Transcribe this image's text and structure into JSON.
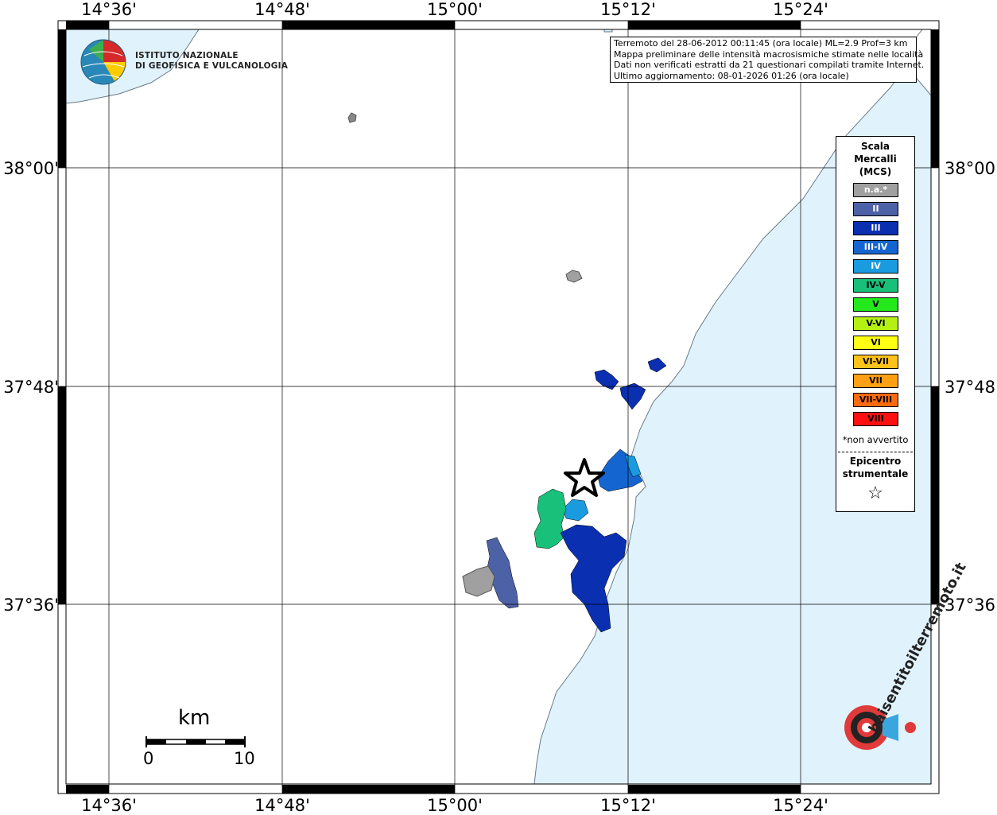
{
  "map": {
    "longitude_ticks": [
      "14°36'",
      "14°48'",
      "15°00'",
      "15°12'",
      "15°24'"
    ],
    "latitude_ticks": [
      "38°00'",
      "37°48'",
      "37°36'"
    ],
    "colors": {
      "sea": "#e0f2fc",
      "land": "#ffffff",
      "coast": "#6a7b88",
      "grid": "#000000"
    }
  },
  "institute": {
    "line1": "ISTITUTO NAZIONALE",
    "line2": "DI GEOFISICA E VULCANOLOGIA",
    "icon": "ingv-globe-logo"
  },
  "info": {
    "line1": "Terremoto del 28-06-2012 00:11:45 (ora locale) ML=2.9 Prof=3 km",
    "line2": "Mappa preliminare delle intensità macrosismiche stimate nelle località",
    "line3": "Dati non verificati estratti da 21 questionari compilati tramite Internet.",
    "line4": "Ultimo aggiornamento: 08-01-2026 01:26 (ora locale)"
  },
  "legend": {
    "title1": "Scala",
    "title2": "Mercalli",
    "title3": "(MCS)",
    "items": [
      {
        "label": "n.a.*",
        "color": "#a0a0a0",
        "text_color": "#ffffff"
      },
      {
        "label": "II",
        "color": "#4d62a6",
        "text_color": "#ffffff"
      },
      {
        "label": "III",
        "color": "#0a2fb0",
        "text_color": "#ffffff"
      },
      {
        "label": "III-IV",
        "color": "#1565d0",
        "text_color": "#ffffff"
      },
      {
        "label": "IV",
        "color": "#1a9be0",
        "text_color": "#ffffff"
      },
      {
        "label": "IV-V",
        "color": "#18c07a",
        "text_color": "#000000"
      },
      {
        "label": "V",
        "color": "#22e81c",
        "text_color": "#000000"
      },
      {
        "label": "V-VI",
        "color": "#b5f014",
        "text_color": "#000000"
      },
      {
        "label": "VI",
        "color": "#ffff14",
        "text_color": "#000000"
      },
      {
        "label": "VI-VII",
        "color": "#ffc21a",
        "text_color": "#000000"
      },
      {
        "label": "VII",
        "color": "#ffa014",
        "text_color": "#000000"
      },
      {
        "label": "VII-VIII",
        "color": "#ff6a10",
        "text_color": "#000000"
      },
      {
        "label": "VIII",
        "color": "#ff1010",
        "text_color": "#000000"
      }
    ],
    "not_felt_note": "*non avvertito",
    "epicenter1": "Epicentro",
    "epicenter2": "strumentale",
    "epicenter_icon": "star-icon"
  },
  "scalebar": {
    "unit": "km",
    "start": "0",
    "end": "10"
  },
  "watermark": {
    "text": "haisentitoilterremoto.it",
    "icon": "haisentito-logo"
  },
  "epicenter_marker": "star-icon"
}
